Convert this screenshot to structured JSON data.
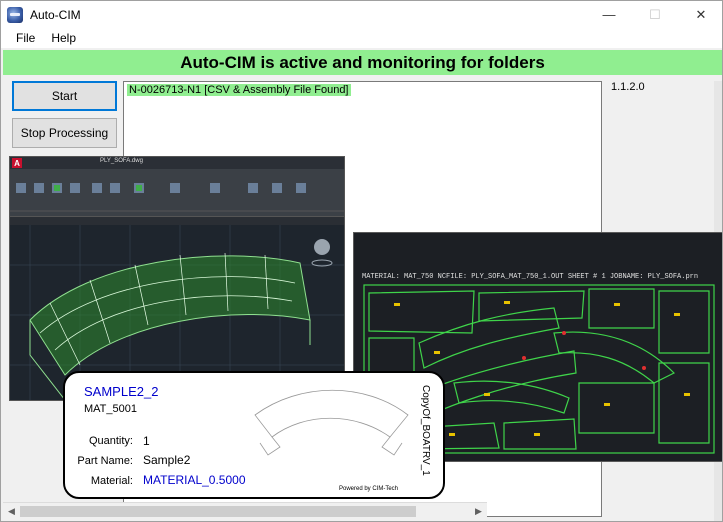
{
  "window": {
    "title": "Auto-CIM",
    "controls": {
      "minimize": "—",
      "maximize": "☐",
      "close": "✕"
    }
  },
  "menu": {
    "items": [
      "File",
      "Help"
    ]
  },
  "status_banner": "Auto-CIM is active and monitoring for folders",
  "buttons": {
    "start": "Start",
    "stop": "Stop Processing"
  },
  "log": {
    "lines": [
      "N-0026713-N1 [CSV & Assembly File Found]"
    ]
  },
  "version": "1.1.2.0",
  "cad_preview": {
    "filename": "PLY_SOFA.dwg",
    "app_logo": "A"
  },
  "nest_preview": {
    "header": "MATERIAL: MAT_750  NCFILE: PLY_SOFA_MAT_750_1.OUT  SHEET # 1 JOBNAME: PLY_SOFA.prn"
  },
  "label": {
    "part_id": "SAMPLE2_2",
    "material_code": "MAT_5001",
    "quantity_label": "Quantity:",
    "quantity": "1",
    "part_name_label": "Part Name:",
    "part_name": "Sample2",
    "material_label": "Material:",
    "material": "MATERIAL_0.5000",
    "side_text": "CopyOf_BOATRV_1",
    "powered_by": "Powered by CIM-Tech"
  },
  "colors": {
    "banner": "#90ee90",
    "focus": "#0078d7",
    "label_blue": "#0000cc"
  },
  "icons": {
    "app": "autocim-app-icon"
  }
}
